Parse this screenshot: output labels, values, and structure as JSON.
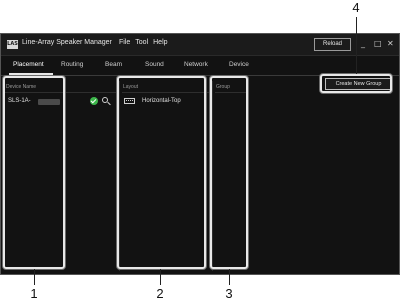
{
  "app": {
    "icon_text": "LAS",
    "title": "Line-Array Speaker Manager"
  },
  "menu": {
    "items": [
      "File",
      "Tool",
      "Help"
    ]
  },
  "titlebar": {
    "reload_label": "Reload",
    "minimize_glyph": "_",
    "maximize_glyph": "□",
    "close_glyph": "✕"
  },
  "tabs": [
    {
      "label": "Placement",
      "active": true
    },
    {
      "label": "Routing"
    },
    {
      "label": "Beam"
    },
    {
      "label": "Sound"
    },
    {
      "label": "Network"
    },
    {
      "label": "Device"
    }
  ],
  "create_group_label": "Create New Group",
  "panels": {
    "device": {
      "header": "Device Name",
      "items": [
        {
          "name": "SLS-1A-"
        }
      ]
    },
    "layout": {
      "header": "Layout",
      "value": "Horizontal-Top",
      "dropdown_glyph": "⌄"
    },
    "group": {
      "header": "Group"
    }
  },
  "callouts": [
    "1",
    "2",
    "3",
    "4"
  ],
  "colors": {
    "status_ok": "#3cb64a",
    "window_bg": "#121212",
    "highlight": "#e8e8e8"
  }
}
